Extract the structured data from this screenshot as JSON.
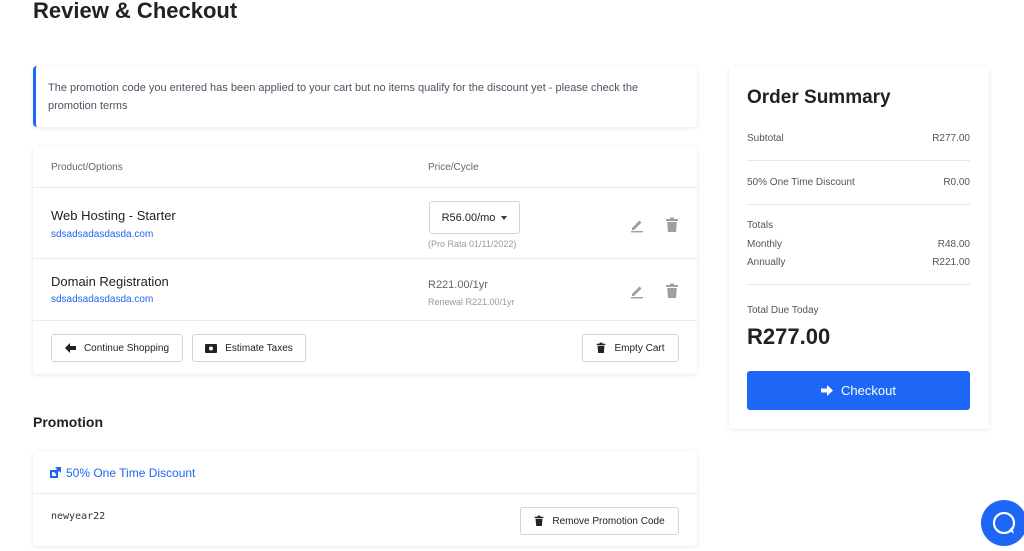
{
  "page": {
    "title": "Review & Checkout"
  },
  "alert": {
    "message": "The promotion code you entered has been applied to your cart but no items qualify for the discount yet - please check the promotion terms"
  },
  "cart": {
    "columns": {
      "product": "Product/Options",
      "price": "Price/Cycle"
    },
    "items": [
      {
        "name": "Web Hosting - Starter",
        "domain": "sdsadsadasdasda.com",
        "price": "R56.00/mo",
        "note": "(Pro Rata 01/11/2022)"
      },
      {
        "name": "Domain Registration",
        "domain": "sdsadsadasdasda.com",
        "price": "R221.00/1yr",
        "note": "Renewal R221.00/1yr"
      }
    ],
    "buttons": {
      "continue": "Continue Shopping",
      "estimate": "Estimate Taxes",
      "empty": "Empty Cart"
    }
  },
  "promotion": {
    "heading": "Promotion",
    "name": "50% One Time Discount",
    "code": "newyear22",
    "remove": "Remove Promotion Code"
  },
  "summary": {
    "title": "Order Summary",
    "subtotal": {
      "label": "Subtotal",
      "value": "R277.00"
    },
    "discount": {
      "label": "50% One Time Discount",
      "value": "R0.00"
    },
    "totals_label": "Totals",
    "monthly": {
      "label": "Monthly",
      "value": "R48.00"
    },
    "annually": {
      "label": "Annually",
      "value": "R221.00"
    },
    "total_due_label": "Total Due Today",
    "total_due": "R277.00",
    "checkout": "Checkout"
  },
  "colors": {
    "accent": "#1e66f5",
    "icon_gray": "#9aa0a6"
  },
  "icons": [
    "pencil-icon",
    "trash-icon",
    "arrow-left-icon",
    "money-icon",
    "external-link-icon",
    "arrow-right-icon",
    "chat-icon",
    "chevron-down-icon"
  ]
}
